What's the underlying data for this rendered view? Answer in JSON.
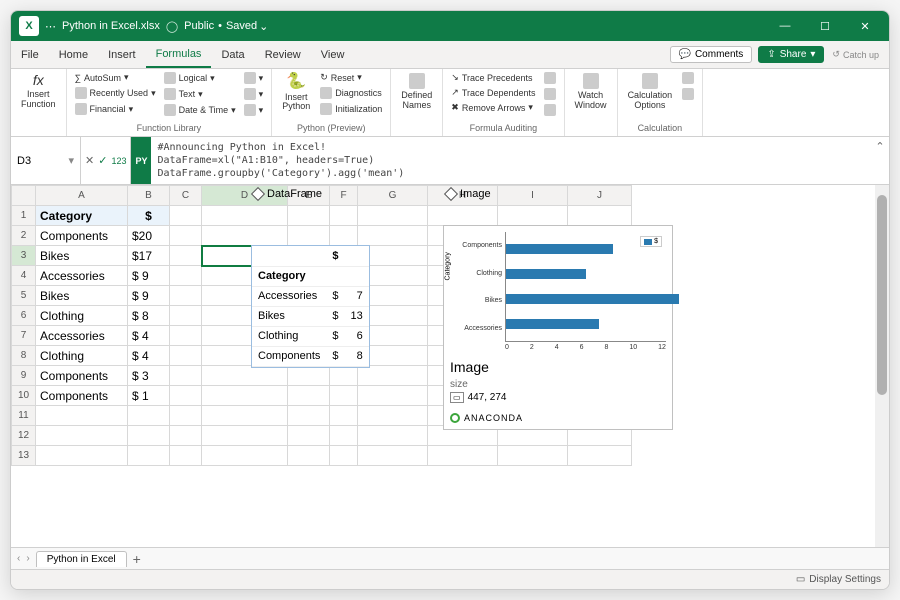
{
  "titlebar": {
    "filename": "Python in Excel.xlsx",
    "visibility": "Public",
    "save_status": "Saved"
  },
  "tabs": [
    "File",
    "Home",
    "Insert",
    "Formulas",
    "Data",
    "Review",
    "View"
  ],
  "active_tab": "Formulas",
  "right_actions": {
    "comments": "Comments",
    "share": "Share",
    "catchup": "Catch up"
  },
  "ribbon": {
    "insert_function": "Insert\nFunction",
    "fl": {
      "autosum": "AutoSum",
      "recently": "Recently Used",
      "financial": "Financial",
      "logical": "Logical",
      "text": "Text",
      "datetime": "Date & Time",
      "label": "Function Library"
    },
    "py": {
      "insert": "Insert\nPython",
      "reset": "Reset",
      "diag": "Diagnostics",
      "init": "Initialization",
      "label": "Python (Preview)"
    },
    "names": {
      "defined": "Defined\nNames",
      "label": ""
    },
    "audit": {
      "precedents": "Trace Precedents",
      "dependents": "Trace Dependents",
      "remove": "Remove Arrows",
      "label": "Formula Auditing"
    },
    "watch": {
      "label_big": "Watch\nWindow"
    },
    "calc": {
      "options": "Calculation\nOptions",
      "label": "Calculation"
    }
  },
  "formula_bar": {
    "cell_ref": "D3",
    "py_badge": "PY",
    "code": "#Announcing Python in Excel!\nDataFrame=xl(\"A1:B10\", headers=True)\nDataFrame.groupby('Category').agg('mean')"
  },
  "columns": [
    "A",
    "B",
    "C",
    "D",
    "E",
    "F",
    "G",
    "H",
    "I",
    "J"
  ],
  "source": {
    "headers": [
      "Category",
      "$"
    ],
    "rows": [
      [
        "Components",
        "$20"
      ],
      [
        "Bikes",
        "$17"
      ],
      [
        "Accessories",
        "$  9"
      ],
      [
        "Bikes",
        "$  9"
      ],
      [
        "Clothing",
        "$  8"
      ],
      [
        "Accessories",
        "$  4"
      ],
      [
        "Clothing",
        "$  4"
      ],
      [
        "Components",
        "$  3"
      ],
      [
        "Components",
        "$  1"
      ]
    ]
  },
  "objects": {
    "dataframe_label": "DataFrame",
    "image_label": "Image"
  },
  "df_result": {
    "money_header": "$",
    "cat_header": "Category",
    "rows": [
      [
        "Accessories",
        "$",
        "7"
      ],
      [
        "Bikes",
        "$",
        "13"
      ],
      [
        "Clothing",
        "$",
        "6"
      ],
      [
        "Components",
        "$",
        "8"
      ]
    ]
  },
  "image_card": {
    "title": "Image",
    "size_label": "size",
    "size_value": "447, 274",
    "powered": "ANACONDA"
  },
  "chart_data": {
    "type": "bar",
    "orientation": "horizontal",
    "categories": [
      "Components",
      "Clothing",
      "Bikes",
      "Accessories"
    ],
    "values": [
      8,
      6,
      13,
      7
    ],
    "xlabel": "",
    "ylabel": "Category",
    "xlim": [
      0,
      12
    ],
    "xticks": [
      0,
      2,
      4,
      6,
      8,
      10,
      12
    ],
    "legend": "$"
  },
  "sheet_tabs": {
    "name": "Python in Excel"
  },
  "statusbar": {
    "display": "Display Settings"
  }
}
